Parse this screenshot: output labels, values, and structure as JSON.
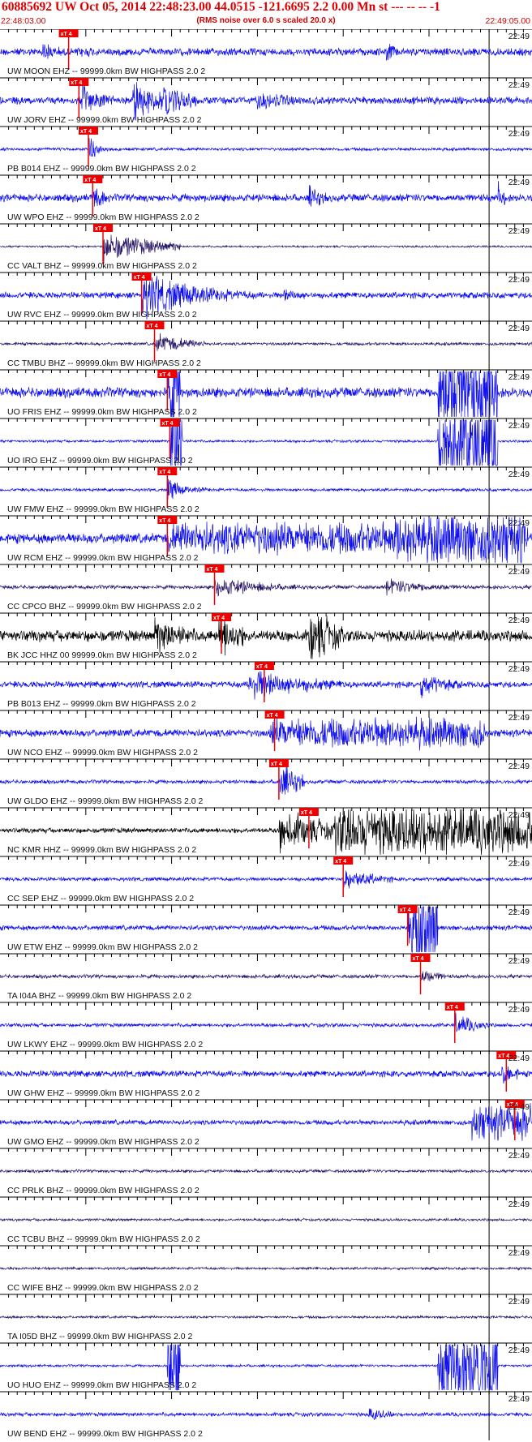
{
  "header": {
    "title": "60885692 UW Oct 05, 2014 22:48:23.00   44.0515 -121.6695  2.2 0.00 Mn st --- -- --   -1",
    "start_time": "22:48:03.00",
    "note": "(RMS noise over 6.0 s scaled 20.0 x)",
    "end_time": "22:49:05.00"
  },
  "minute_label": "22:49",
  "pick_label": "xT 4",
  "colors": {
    "blue": "#1010ee",
    "dark": "#2a1868",
    "black": "#000000",
    "pick": "#ee0000"
  },
  "chart_data": {
    "type": "line",
    "x_unit": "seconds after 22:48:03.00",
    "xlim": [
      0,
      62
    ],
    "minute_mark_s": 57,
    "traces": [
      {
        "label": "UW MOON EHZ -- 99999.0km BW  HIGHPASS  2.0  2",
        "color": "blue",
        "pick_s": 8.0,
        "amp": 0.3,
        "bursts": [
          [
            5,
            8,
            40,
            0.9
          ],
          [
            9,
            10,
            5,
            0.5
          ],
          [
            45,
            1.5,
            4,
            1.1
          ]
        ]
      },
      {
        "label": "UW JORV EHZ -- 99999.0km BW  HIGHPASS  2.0  2",
        "color": "blue",
        "pick_s": 9.2,
        "amp": 0.3,
        "bursts": [
          [
            9.5,
            9,
            18,
            1.3
          ],
          [
            15.5,
            5,
            4,
            1.8
          ],
          [
            19,
            4,
            3,
            1.5
          ],
          [
            30,
            10,
            5,
            0.8
          ]
        ]
      },
      {
        "label": "PB B014 EHZ -- 99999.0km BW  HIGHPASS  2.0  2",
        "color": "blue",
        "pick_s": 10.3,
        "amp": 0.12,
        "bursts": [
          [
            10.3,
            1.5,
            6,
            1.6
          ],
          [
            11,
            4,
            3,
            0.25
          ]
        ]
      },
      {
        "label": "UW WPO EHZ -- 99999.0km BW  HIGHPASS  2.0  2",
        "color": "blue",
        "pick_s": 10.8,
        "amp": 0.3,
        "bursts": [
          [
            10.8,
            2,
            4,
            1.3
          ],
          [
            36,
            3,
            4,
            1.0
          ],
          [
            58,
            1,
            3,
            1.4
          ]
        ]
      },
      {
        "label": "CC VALT BHZ -- 99999.0km BW  HIGHPASS  2.0  2",
        "color": "dark",
        "pick_s": 12.0,
        "amp": 0.08,
        "bursts": [
          [
            12,
            9,
            4,
            1.3
          ]
        ]
      },
      {
        "label": "UW RVC EHZ -- 99999.0km BW  HIGHPASS  2.0  2",
        "color": "blue",
        "pick_s": 16.5,
        "amp": 0.25,
        "bursts": [
          [
            16.5,
            17,
            12,
            2.0
          ],
          [
            33,
            5,
            4,
            0.6
          ]
        ]
      },
      {
        "label": "CC TMBU BHZ -- 99999.0km BW  HIGHPASS  2.0  2",
        "color": "dark",
        "pick_s": 18.0,
        "amp": 0.12,
        "bursts": [
          [
            18,
            6,
            4,
            0.9
          ]
        ]
      },
      {
        "label": "UO FRIS EHZ -- 99999.0km BW  HIGHPASS  2.0  2",
        "color": "blue",
        "pick_s": 19.5,
        "amp": 0.4,
        "bursts": [
          [
            19.5,
            1.5,
            1,
            4.0
          ],
          [
            51,
            7,
            1,
            4.0
          ]
        ]
      },
      {
        "label": "UO IRO EHZ -- 99999.0km BW  HIGHPASS  2.0  2",
        "color": "blue",
        "pick_s": 19.8,
        "amp": 0.1,
        "bursts": [
          [
            19.8,
            1.5,
            1,
            4.0
          ],
          [
            51,
            7,
            1,
            4.0
          ]
        ]
      },
      {
        "label": "UW FMW EHZ -- 99999.0km BW  HIGHPASS  2.0  2",
        "color": "blue",
        "pick_s": 19.5,
        "amp": 0.12,
        "bursts": [
          [
            19.5,
            2,
            3,
            1.1
          ],
          [
            21,
            5,
            3,
            0.35
          ]
        ]
      },
      {
        "label": "UW RCM EHZ -- 99999.0km BW  HIGHPASS  2.0  2",
        "color": "blue",
        "pick_s": 19.5,
        "amp": 0.4,
        "bursts": [
          [
            19.5,
            42,
            1,
            1.3
          ],
          [
            46,
            15,
            1,
            2.1
          ]
        ]
      },
      {
        "label": "CC CPCO BHZ -- 99999.0km BW  HIGHPASS  2.0  2",
        "color": "dark",
        "pick_s": 25.0,
        "amp": 0.15,
        "bursts": [
          [
            25,
            10,
            5,
            0.9
          ],
          [
            45,
            10,
            5,
            0.7
          ]
        ]
      },
      {
        "label": "BK JCC HHZ 00 99999.0km BW  HIGHPASS  2.0  2",
        "color": "black",
        "pick_s": 25.8,
        "amp": 0.45,
        "bursts": [
          [
            18,
            5,
            3,
            1.6
          ],
          [
            25.5,
            3,
            3,
            2.2
          ],
          [
            36,
            4,
            3,
            2.5
          ]
        ]
      },
      {
        "label": "PB B013 EHZ -- 99999.0km BW  HIGHPASS  2.0  2",
        "color": "blue",
        "pick_s": 30.8,
        "amp": 0.25,
        "bursts": [
          [
            29,
            12,
            5,
            1.4
          ],
          [
            49,
            5,
            4,
            1.1
          ]
        ]
      },
      {
        "label": "UW NCO EHZ -- 99999.0km BW  HIGHPASS  2.0  2",
        "color": "blue",
        "pick_s": 32.0,
        "amp": 0.3,
        "bursts": [
          [
            31.5,
            25,
            1,
            1.2
          ]
        ]
      },
      {
        "label": "UW GLDO EHZ -- 99999.0km BW  HIGHPASS  2.0  2",
        "color": "blue",
        "pick_s": 32.5,
        "amp": 0.15,
        "bursts": [
          [
            32.5,
            3,
            3,
            1.6
          ]
        ]
      },
      {
        "label": "NC KMR HHZ -- 99999.0km BW  HIGHPASS  2.0  2",
        "color": "black",
        "pick_s": 36.0,
        "amp": 0.2,
        "bursts": [
          [
            32.5,
            7,
            3,
            1.8
          ],
          [
            39,
            24,
            1,
            1.9
          ]
        ]
      },
      {
        "label": "CC SEP EHZ -- 99999.0km BW  HIGHPASS  2.0  2",
        "color": "blue",
        "pick_s": 40.0,
        "amp": 0.15,
        "bursts": [
          [
            40,
            6,
            4,
            0.9
          ]
        ]
      },
      {
        "label": "UW ETW EHZ -- 99999.0km BW  HIGHPASS  2.0  2",
        "color": "blue",
        "pick_s": 47.5,
        "amp": 0.2,
        "bursts": [
          [
            47.5,
            3.5,
            1,
            3.6
          ]
        ]
      },
      {
        "label": "TA I04A BHZ -- 99999.0km BW  HIGHPASS  2.0  2",
        "color": "dark",
        "pick_s": 49.0,
        "amp": 0.15,
        "bursts": [
          [
            49,
            3,
            3,
            0.7
          ]
        ]
      },
      {
        "label": "UW LKWY EHZ -- 99999.0km BW  HIGHPASS  2.0  2",
        "color": "blue",
        "pick_s": 53.0,
        "amp": 0.15,
        "bursts": [
          [
            53,
            4,
            4,
            1.0
          ]
        ]
      },
      {
        "label": "UW GHW EHZ -- 99999.0km BW  HIGHPASS  2.0  2",
        "color": "blue",
        "pick_s": 59.0,
        "amp": 0.25,
        "bursts": [
          [
            58.5,
            2,
            3,
            1.2
          ]
        ]
      },
      {
        "label": "UW GMO EHZ -- 99999.0km BW  HIGHPASS  2.0  2",
        "color": "blue",
        "pick_s": 60.0,
        "amp": 0.2,
        "bursts": [
          [
            55,
            7,
            1,
            1.4
          ]
        ]
      },
      {
        "label": "CC PRLK BHZ -- 99999.0km BW  HIGHPASS  2.0  2",
        "color": "dark",
        "pick_s": null,
        "amp": 0.12,
        "bursts": []
      },
      {
        "label": "CC TCBU BHZ -- 99999.0km BW  HIGHPASS  2.0  2",
        "color": "dark",
        "pick_s": null,
        "amp": 0.1,
        "bursts": []
      },
      {
        "label": "CC WIFE BHZ -- 99999.0km BW  HIGHPASS  2.0  2",
        "color": "dark",
        "pick_s": null,
        "amp": 0.1,
        "bursts": []
      },
      {
        "label": "TA I05D BHZ -- 99999.0km BW  HIGHPASS  2.0  2",
        "color": "dark",
        "pick_s": null,
        "amp": 0.1,
        "bursts": []
      },
      {
        "label": "UO HUO EHZ -- 99999.0km BW  HIGHPASS  2.0  2",
        "color": "blue",
        "pick_s": null,
        "amp": 0.1,
        "bursts": [
          [
            19.5,
            1.5,
            1,
            4.0
          ],
          [
            51,
            7,
            1,
            4.0
          ]
        ]
      },
      {
        "label": "UW BEND EHZ -- 99999.0km BW  HIGHPASS  2.0  2",
        "color": "blue",
        "pick_s": null,
        "amp": 0.15,
        "bursts": [
          [
            43,
            3,
            3,
            0.6
          ]
        ]
      }
    ]
  }
}
